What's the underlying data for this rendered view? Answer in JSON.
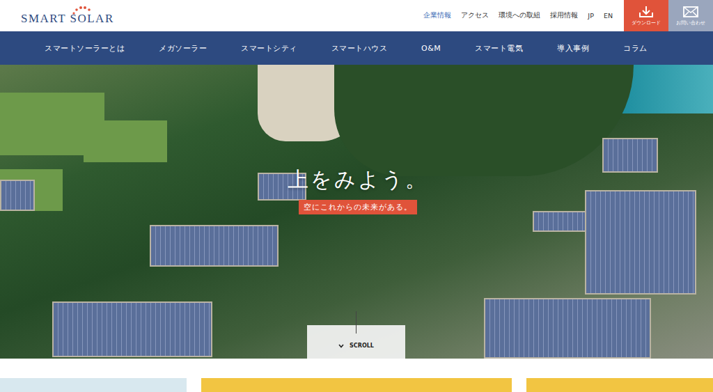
{
  "logo": "SMART SOLAR",
  "top_links": [
    {
      "label": "企業情報",
      "selected": true
    },
    {
      "label": "アクセス",
      "selected": false
    },
    {
      "label": "環境への取組",
      "selected": false
    },
    {
      "label": "採用情報",
      "selected": false
    },
    {
      "label": "JP",
      "selected": false
    },
    {
      "label": "EN",
      "selected": false
    }
  ],
  "buttons": [
    {
      "label": "ダウンロード",
      "kind": "download"
    },
    {
      "label": "お問い合わせ",
      "kind": "contact"
    }
  ],
  "nav": [
    "スマートソーラーとは",
    "メガソーラー",
    "スマートシティ",
    "スマートハウス",
    "O&M",
    "スマート電気",
    "導入事例",
    "コラム"
  ],
  "hero": {
    "headline": "上をみよう。",
    "tagline": "空にこれからの未来がある。",
    "scroll": "SCROLL"
  }
}
